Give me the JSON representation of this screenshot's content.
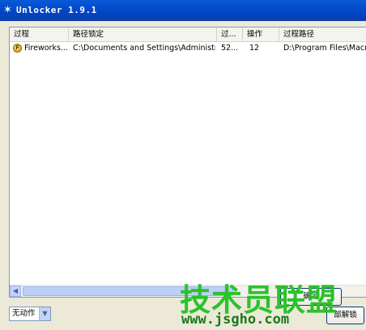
{
  "window": {
    "title": "Unlocker 1.9.1",
    "icon": "wand-icon"
  },
  "list": {
    "columns": [
      {
        "label": "过程"
      },
      {
        "label": "路径锁定"
      },
      {
        "label": "过..."
      },
      {
        "label": "操作"
      },
      {
        "label": "过程路径"
      }
    ],
    "rows": [
      {
        "process": "Fireworks....",
        "path_locked": "C:\\Documents and Settings\\Administrat...",
        "pid": "52...",
        "handle": "12",
        "process_path": "D:\\Program Files\\Macrom"
      }
    ]
  },
  "footer": {
    "action_select": {
      "value": "无动作"
    },
    "buttons": {
      "confirm_partial": "确定",
      "unlock_all_partial": "部解锁"
    }
  },
  "watermark": {
    "text": "技术员联盟",
    "url": "www.jsgho.com"
  },
  "colors": {
    "titlebar": "#0a5ad8",
    "watermark": "#2bc22b"
  }
}
